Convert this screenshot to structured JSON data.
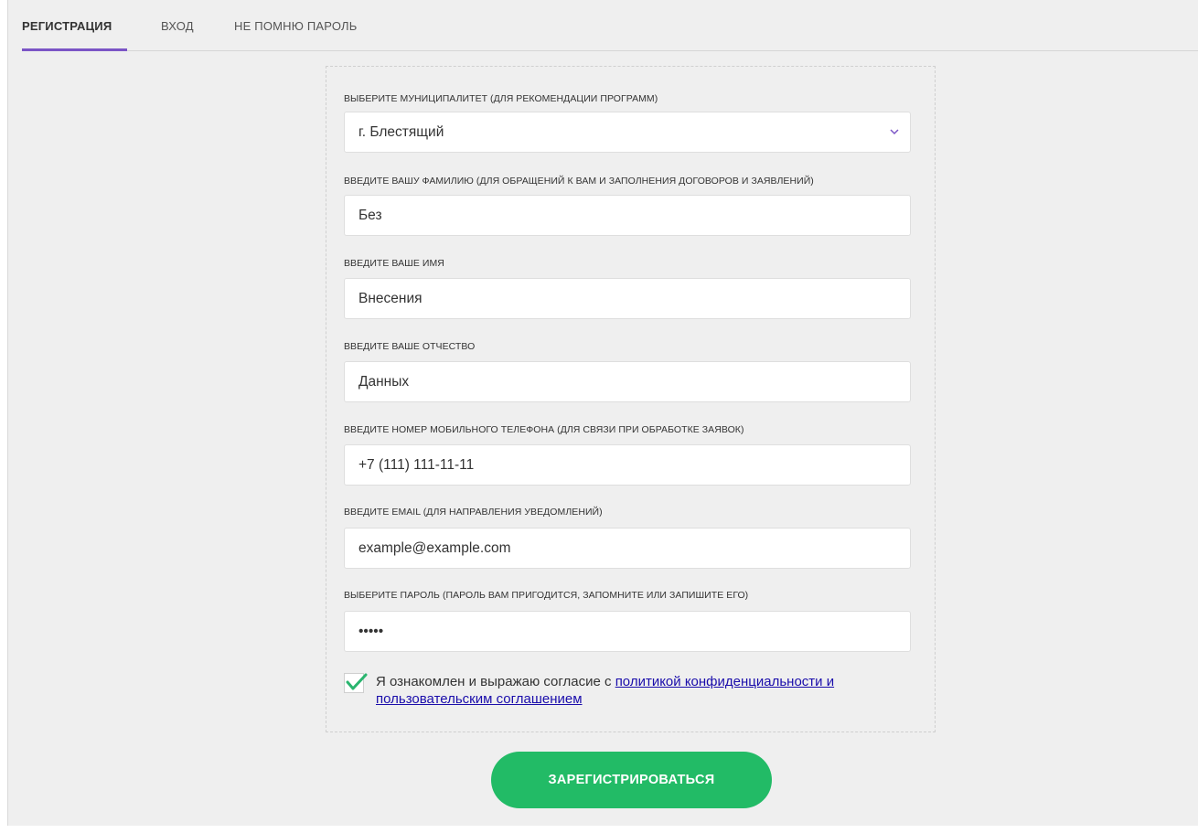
{
  "tabs": {
    "registration": "РЕГИСТРАЦИЯ",
    "login": "ВХОД",
    "forgot_password": "НЕ ПОМНЮ ПАРОЛЬ"
  },
  "form": {
    "municipality": {
      "label": "ВЫБЕРИТЕ МУНИЦИПАЛИТЕТ (ДЛЯ РЕКОМЕНДАЦИИ ПРОГРАММ)",
      "value": "г. Блестящий"
    },
    "surname": {
      "label": "ВВЕДИТЕ ВАШУ ФАМИЛИЮ (ДЛЯ ОБРАЩЕНИЙ К ВАМ И ЗАПОЛНЕНИЯ ДОГОВОРОВ И ЗАЯВЛЕНИЙ)",
      "value": "Без"
    },
    "name": {
      "label": "ВВЕДИТЕ ВАШЕ ИМЯ",
      "value": "Внесения"
    },
    "patronymic": {
      "label": "ВВЕДИТЕ ВАШЕ ОТЧЕСТВО",
      "value": "Данных"
    },
    "phone": {
      "label": "ВВЕДИТЕ НОМЕР МОБИЛЬНОГО ТЕЛЕФОНА (ДЛЯ СВЯЗИ ПРИ ОБРАБОТКЕ ЗАЯВОК)",
      "value": "+7 (111) 111-11-11"
    },
    "email": {
      "label": "ВВЕДИТЕ EMAIL (ДЛЯ НАПРАВЛЕНИЯ УВЕДОМЛЕНИЙ)",
      "value": "example@example.com"
    },
    "password": {
      "label": "ВЫБЕРИТЕ ПАРОЛЬ (ПАРОЛЬ ВАМ ПРИГОДИТСЯ, ЗАПОМНИТЕ ИЛИ ЗАПИШИТЕ ЕГО)",
      "value": "•••••"
    },
    "consent": {
      "checked": true,
      "text": "Я ознакомлен и выражаю согласие с ",
      "link": "политикой конфиденциальности и пользовательским соглашением"
    },
    "submit_label": "ЗАРЕГИСТРИРОВАТЬСЯ"
  },
  "colors": {
    "accent": "#7b55c6",
    "submit": "#22bb66",
    "check": "#2ab56f",
    "link": "#1a0dab"
  },
  "icons": {
    "dropdown": "chevron-down-icon",
    "checkmark": "checkmark-icon"
  }
}
